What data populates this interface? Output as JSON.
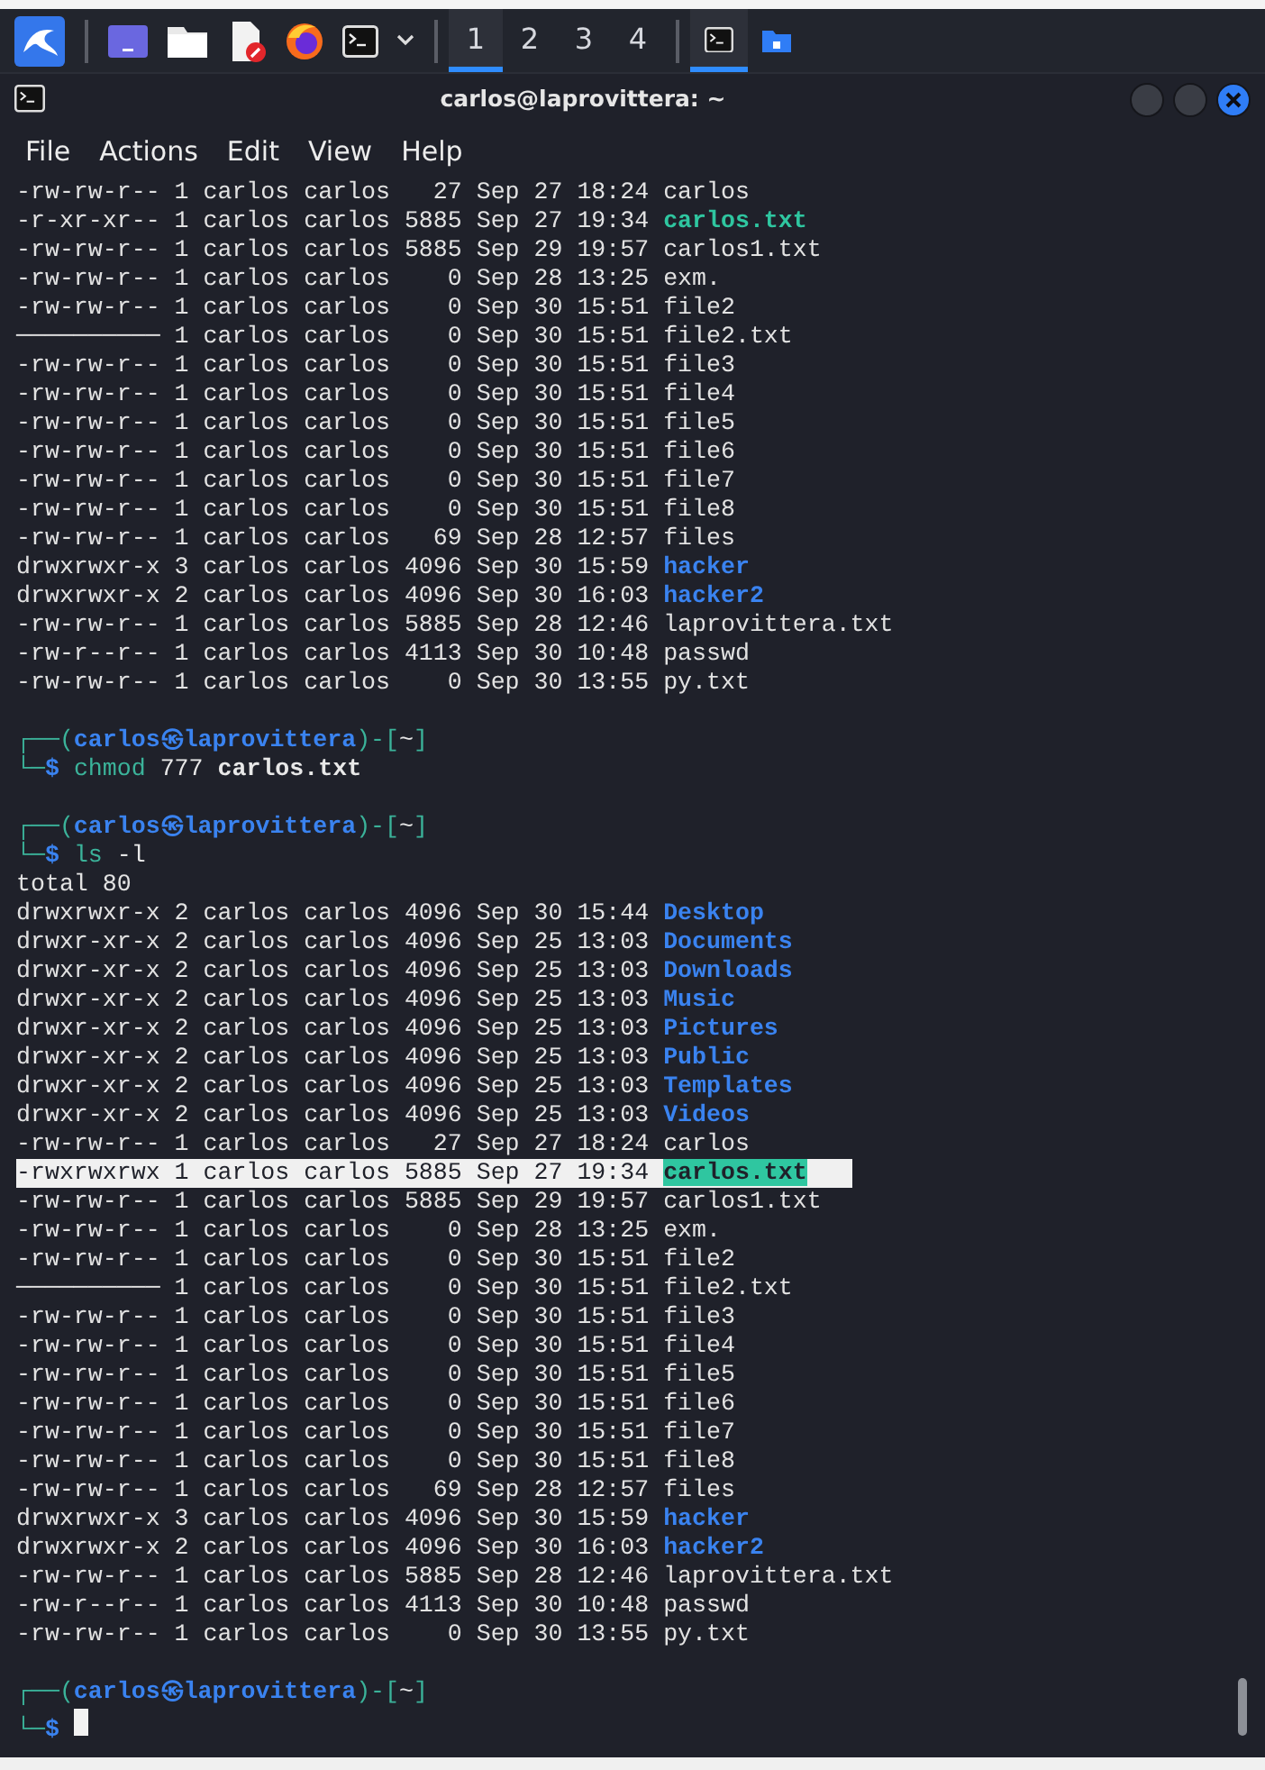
{
  "taskbar": {
    "workspaces": [
      {
        "label": "1",
        "selected": true
      },
      {
        "label": "2",
        "selected": false
      },
      {
        "label": "3",
        "selected": false
      },
      {
        "label": "4",
        "selected": false
      }
    ],
    "tasks": [
      {
        "kind": "terminal",
        "active": true
      },
      {
        "kind": "folder",
        "active": false
      }
    ]
  },
  "window": {
    "title": "carlos@laprovittera: ~",
    "menu": [
      "File",
      "Actions",
      "Edit",
      "View",
      "Help"
    ]
  },
  "terminal": {
    "lines": [
      {
        "kind": "file",
        "info": "-rw-rw-r-- 1 carlos carlos   27 Sep 27 18:24",
        "name": "carlos",
        "highlighted": false
      },
      {
        "kind": "exec",
        "info": "-r-xr-xr-- 1 carlos carlos 5885 Sep 27 19:34",
        "name": "carlos.txt",
        "highlighted": false
      },
      {
        "kind": "file",
        "info": "-rw-rw-r-- 1 carlos carlos 5885 Sep 29 19:57",
        "name": "carlos1.txt",
        "highlighted": false
      },
      {
        "kind": "file",
        "info": "-rw-rw-r-- 1 carlos carlos    0 Sep 28 13:25",
        "name": "exm.",
        "highlighted": false
      },
      {
        "kind": "file",
        "info": "-rw-rw-r-- 1 carlos carlos    0 Sep 30 15:51",
        "name": "file2",
        "highlighted": false
      },
      {
        "kind": "file",
        "info": "────────── 1 carlos carlos    0 Sep 30 15:51",
        "name": "file2.txt",
        "highlighted": false
      },
      {
        "kind": "file",
        "info": "-rw-rw-r-- 1 carlos carlos    0 Sep 30 15:51",
        "name": "file3",
        "highlighted": false
      },
      {
        "kind": "file",
        "info": "-rw-rw-r-- 1 carlos carlos    0 Sep 30 15:51",
        "name": "file4",
        "highlighted": false
      },
      {
        "kind": "file",
        "info": "-rw-rw-r-- 1 carlos carlos    0 Sep 30 15:51",
        "name": "file5",
        "highlighted": false
      },
      {
        "kind": "file",
        "info": "-rw-rw-r-- 1 carlos carlos    0 Sep 30 15:51",
        "name": "file6",
        "highlighted": false
      },
      {
        "kind": "file",
        "info": "-rw-rw-r-- 1 carlos carlos    0 Sep 30 15:51",
        "name": "file7",
        "highlighted": false
      },
      {
        "kind": "file",
        "info": "-rw-rw-r-- 1 carlos carlos    0 Sep 30 15:51",
        "name": "file8",
        "highlighted": false
      },
      {
        "kind": "file",
        "info": "-rw-rw-r-- 1 carlos carlos   69 Sep 28 12:57",
        "name": "files",
        "highlighted": false
      },
      {
        "kind": "dir",
        "info": "drwxrwxr-x 3 carlos carlos 4096 Sep 30 15:59",
        "name": "hacker",
        "highlighted": false
      },
      {
        "kind": "dir",
        "info": "drwxrwxr-x 2 carlos carlos 4096 Sep 30 16:03",
        "name": "hacker2",
        "highlighted": false
      },
      {
        "kind": "file",
        "info": "-rw-rw-r-- 1 carlos carlos 5885 Sep 28 12:46",
        "name": "laprovittera.txt",
        "highlighted": false
      },
      {
        "kind": "file",
        "info": "-rw-r--r-- 1 carlos carlos 4113 Sep 30 10:48",
        "name": "passwd",
        "highlighted": false
      },
      {
        "kind": "file",
        "info": "-rw-rw-r-- 1 carlos carlos    0 Sep 30 13:55",
        "name": "py.txt",
        "highlighted": false
      },
      {
        "kind": "blank"
      },
      {
        "kind": "prompt",
        "top": "┌──(",
        "user": "carlos",
        "symbol": "㉿",
        "host": "laprovittera",
        "mid": ")-[",
        "dir": "~",
        "close": "]",
        "bottom": "└─",
        "sigil": "$",
        "command": "chmod",
        "args": [
          {
            "text": "777",
            "bold": false
          },
          {
            "text": "carlos.txt",
            "bold": true
          }
        ],
        "cursor": false
      },
      {
        "kind": "blank"
      },
      {
        "kind": "prompt",
        "top": "┌──(",
        "user": "carlos",
        "symbol": "㉿",
        "host": "laprovittera",
        "mid": ")-[",
        "dir": "~",
        "close": "]",
        "bottom": "└─",
        "sigil": "$",
        "command": "ls",
        "args": [
          {
            "text": "-l",
            "bold": false
          }
        ],
        "cursor": false
      },
      {
        "kind": "text",
        "text": "total 80"
      },
      {
        "kind": "dir",
        "info": "drwxrwxr-x 2 carlos carlos 4096 Sep 30 15:44",
        "name": "Desktop",
        "highlighted": false
      },
      {
        "kind": "dir",
        "info": "drwxr-xr-x 2 carlos carlos 4096 Sep 25 13:03",
        "name": "Documents",
        "highlighted": false
      },
      {
        "kind": "dir",
        "info": "drwxr-xr-x 2 carlos carlos 4096 Sep 25 13:03",
        "name": "Downloads",
        "highlighted": false
      },
      {
        "kind": "dir",
        "info": "drwxr-xr-x 2 carlos carlos 4096 Sep 25 13:03",
        "name": "Music",
        "highlighted": false
      },
      {
        "kind": "dir",
        "info": "drwxr-xr-x 2 carlos carlos 4096 Sep 25 13:03",
        "name": "Pictures",
        "highlighted": false
      },
      {
        "kind": "dir",
        "info": "drwxr-xr-x 2 carlos carlos 4096 Sep 25 13:03",
        "name": "Public",
        "highlighted": false
      },
      {
        "kind": "dir",
        "info": "drwxr-xr-x 2 carlos carlos 4096 Sep 25 13:03",
        "name": "Templates",
        "highlighted": false
      },
      {
        "kind": "dir",
        "info": "drwxr-xr-x 2 carlos carlos 4096 Sep 25 13:03",
        "name": "Videos",
        "highlighted": false
      },
      {
        "kind": "file",
        "info": "-rw-rw-r-- 1 carlos carlos   27 Sep 27 18:24",
        "name": "carlos",
        "highlighted": false
      },
      {
        "kind": "exec",
        "info": "-rwxrwxrwx 1 carlos carlos 5885 Sep 27 19:34",
        "name": "carlos.txt",
        "highlighted": true
      },
      {
        "kind": "file",
        "info": "-rw-rw-r-- 1 carlos carlos 5885 Sep 29 19:57",
        "name": "carlos1.txt",
        "highlighted": false
      },
      {
        "kind": "file",
        "info": "-rw-rw-r-- 1 carlos carlos    0 Sep 28 13:25",
        "name": "exm.",
        "highlighted": false
      },
      {
        "kind": "file",
        "info": "-rw-rw-r-- 1 carlos carlos    0 Sep 30 15:51",
        "name": "file2",
        "highlighted": false
      },
      {
        "kind": "file",
        "info": "────────── 1 carlos carlos    0 Sep 30 15:51",
        "name": "file2.txt",
        "highlighted": false
      },
      {
        "kind": "file",
        "info": "-rw-rw-r-- 1 carlos carlos    0 Sep 30 15:51",
        "name": "file3",
        "highlighted": false
      },
      {
        "kind": "file",
        "info": "-rw-rw-r-- 1 carlos carlos    0 Sep 30 15:51",
        "name": "file4",
        "highlighted": false
      },
      {
        "kind": "file",
        "info": "-rw-rw-r-- 1 carlos carlos    0 Sep 30 15:51",
        "name": "file5",
        "highlighted": false
      },
      {
        "kind": "file",
        "info": "-rw-rw-r-- 1 carlos carlos    0 Sep 30 15:51",
        "name": "file6",
        "highlighted": false
      },
      {
        "kind": "file",
        "info": "-rw-rw-r-- 1 carlos carlos    0 Sep 30 15:51",
        "name": "file7",
        "highlighted": false
      },
      {
        "kind": "file",
        "info": "-rw-rw-r-- 1 carlos carlos    0 Sep 30 15:51",
        "name": "file8",
        "highlighted": false
      },
      {
        "kind": "file",
        "info": "-rw-rw-r-- 1 carlos carlos   69 Sep 28 12:57",
        "name": "files",
        "highlighted": false
      },
      {
        "kind": "dir",
        "info": "drwxrwxr-x 3 carlos carlos 4096 Sep 30 15:59",
        "name": "hacker",
        "highlighted": false
      },
      {
        "kind": "dir",
        "info": "drwxrwxr-x 2 carlos carlos 4096 Sep 30 16:03",
        "name": "hacker2",
        "highlighted": false
      },
      {
        "kind": "file",
        "info": "-rw-rw-r-- 1 carlos carlos 5885 Sep 28 12:46",
        "name": "laprovittera.txt",
        "highlighted": false
      },
      {
        "kind": "file",
        "info": "-rw-r--r-- 1 carlos carlos 4113 Sep 30 10:48",
        "name": "passwd",
        "highlighted": false
      },
      {
        "kind": "file",
        "info": "-rw-rw-r-- 1 carlos carlos    0 Sep 30 13:55",
        "name": "py.txt",
        "highlighted": false
      },
      {
        "kind": "blank"
      },
      {
        "kind": "prompt",
        "top": "┌──(",
        "user": "carlos",
        "symbol": "㉿",
        "host": "laprovittera",
        "mid": ")-[",
        "dir": "~",
        "close": "]",
        "bottom": "└─",
        "sigil": "$",
        "cursor": true
      }
    ]
  }
}
